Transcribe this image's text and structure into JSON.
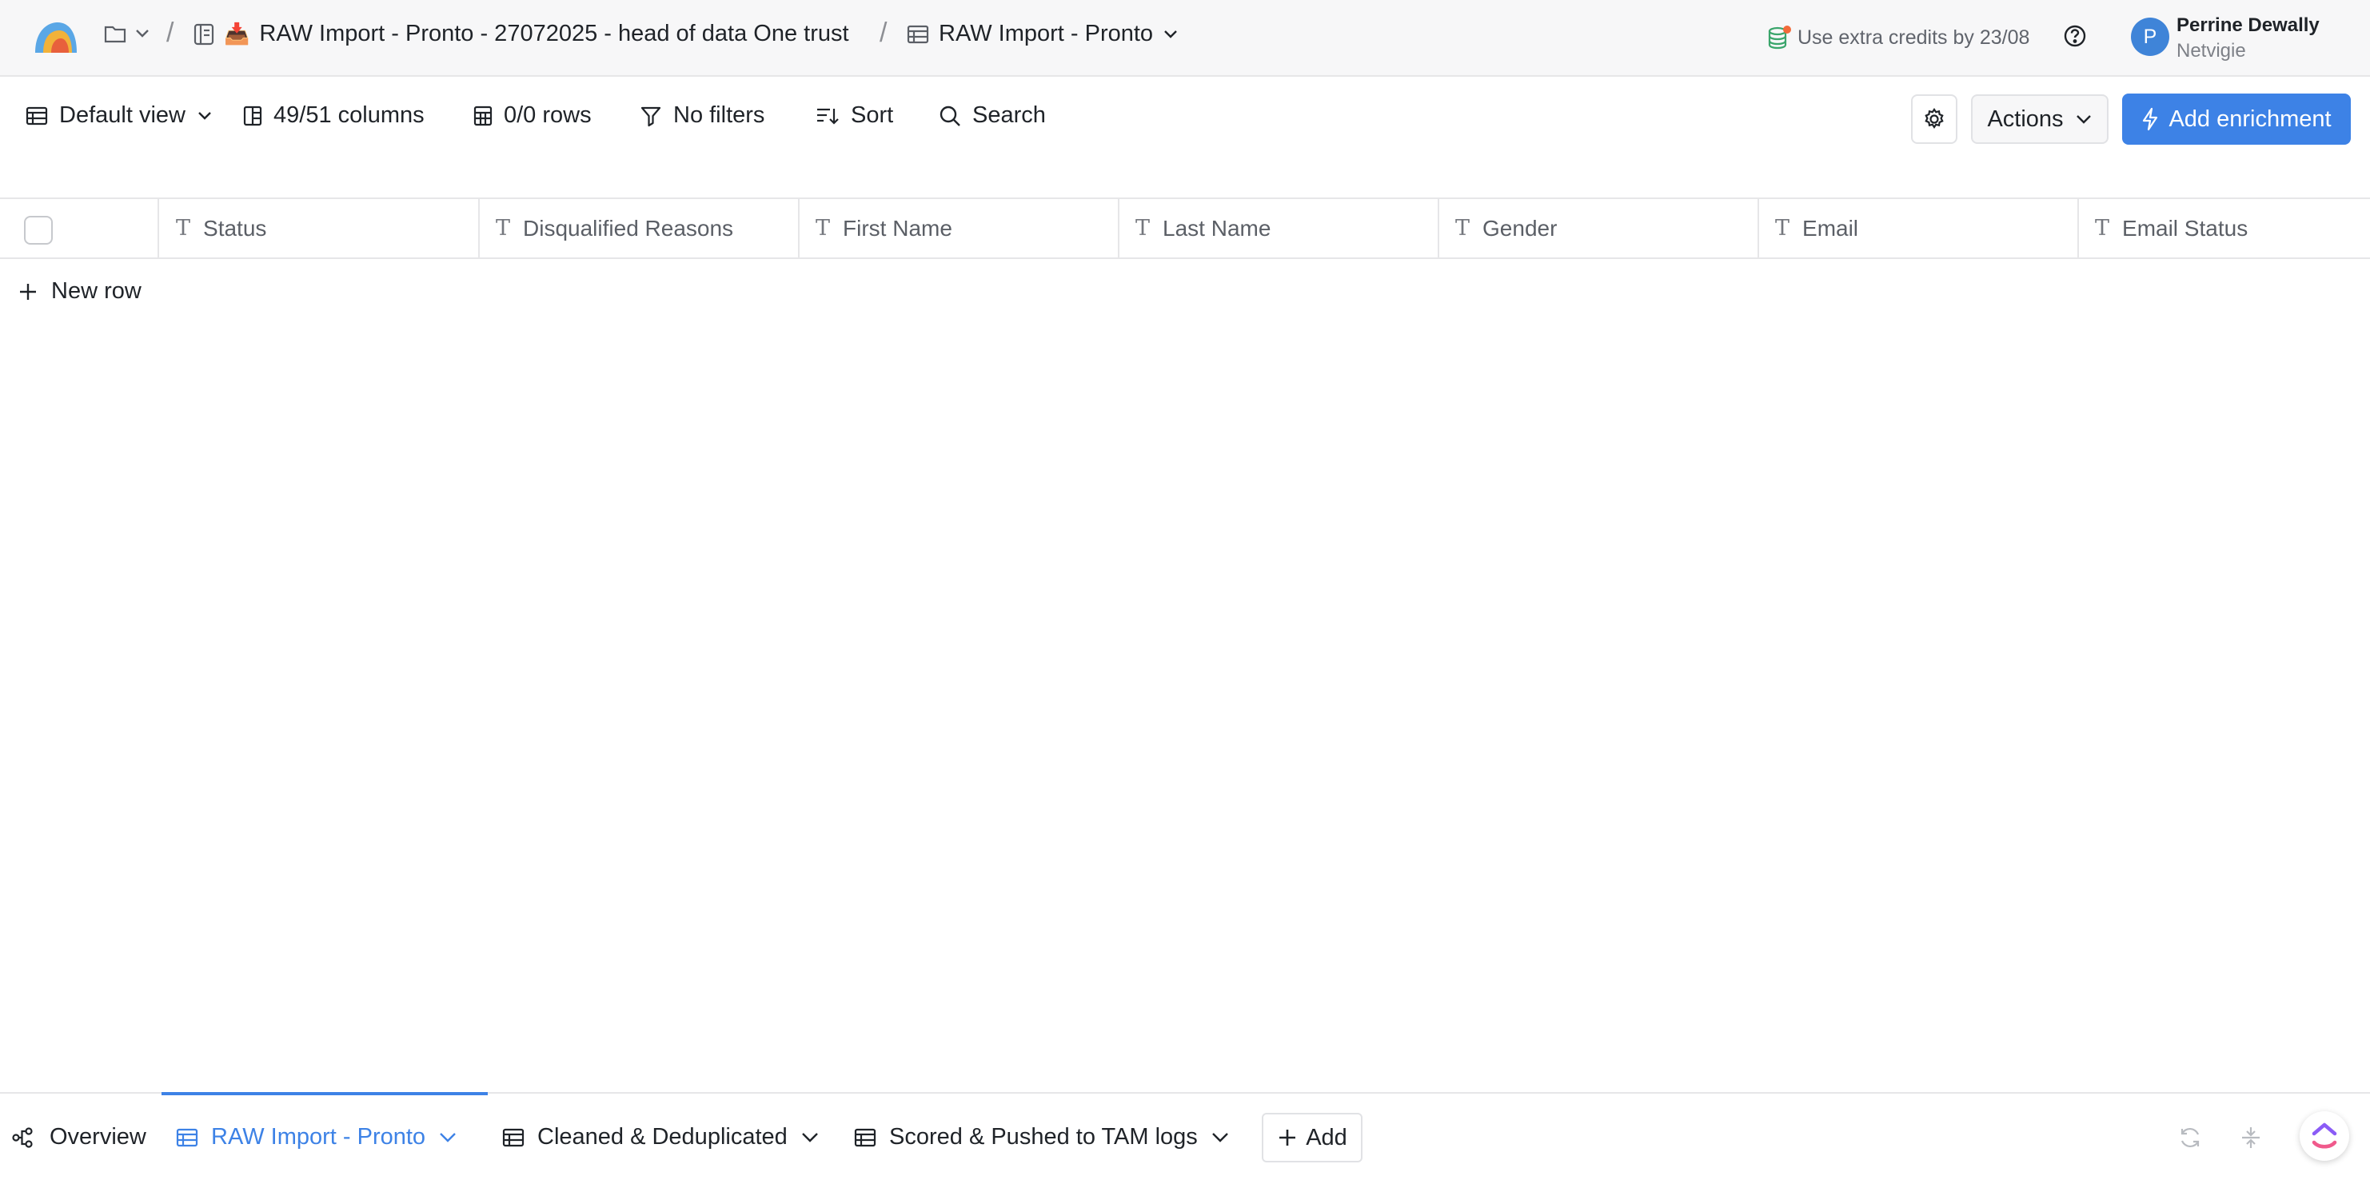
{
  "breadcrumb": {
    "workbook_emoji": "📥",
    "workbook": "RAW Import - Pronto - 27072025 - head of data One trust",
    "table": "RAW Import - Pronto",
    "separator": "/"
  },
  "header": {
    "credits_text": "Use extra credits by 23/08",
    "user": {
      "initial": "P",
      "name": "Perrine Dewally",
      "org": "Netvigie"
    }
  },
  "toolbar": {
    "view": "Default view",
    "columns": "49/51 columns",
    "rows": "0/0 rows",
    "filters": "No filters",
    "sort": "Sort",
    "search": "Search",
    "actions": "Actions",
    "add_enrichment": "Add enrichment"
  },
  "grid": {
    "columns": [
      "Status",
      "Disqualified Reasons",
      "First Name",
      "Last Name",
      "Gender",
      "Email",
      "Email Status"
    ],
    "column_type_glyph": "T",
    "new_row": "New row"
  },
  "bottom_tabs": {
    "overview": "Overview",
    "tables": [
      "RAW Import - Pronto",
      "Cleaned & Deduplicated",
      "Scored & Pushed to TAM logs"
    ],
    "active_index": 0,
    "add": "Add"
  },
  "colors": {
    "accent": "#3d82e6",
    "avatar": "#3f84d8",
    "credits_dot": "#f26b3a"
  }
}
